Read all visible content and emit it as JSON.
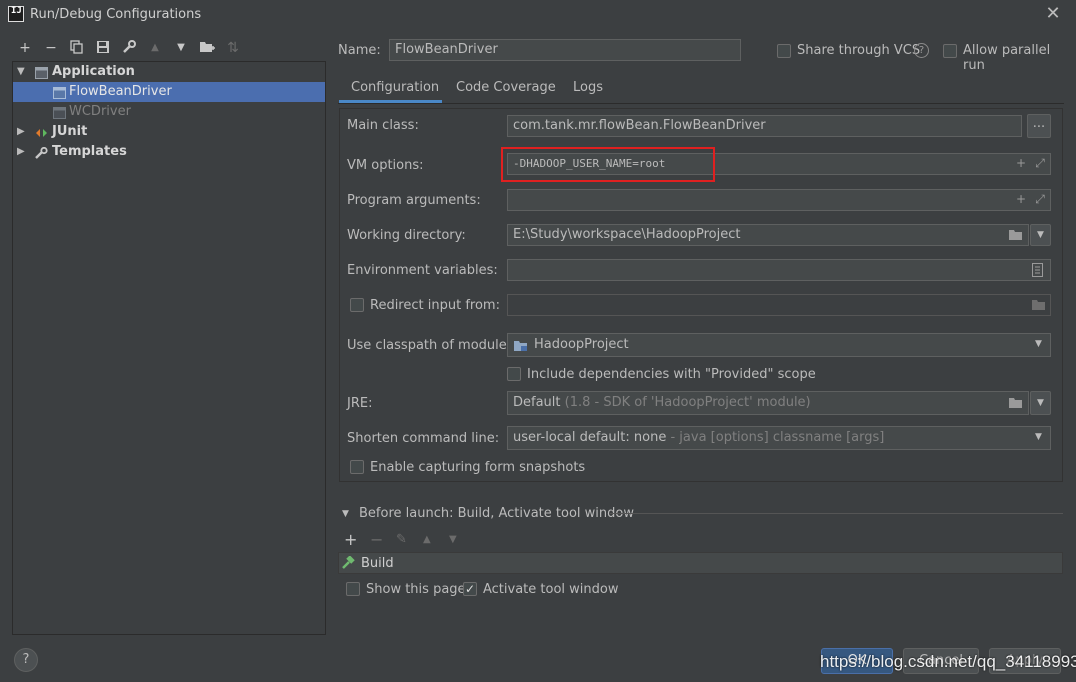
{
  "window": {
    "title": "Run/Debug Configurations",
    "app_icon": "intellij-icon",
    "app_icon_text": "IJ",
    "close_glyph": "✕"
  },
  "toolbar": {
    "icons": [
      "add-icon",
      "remove-icon",
      "copy-icon",
      "save-icon",
      "wrench-icon",
      "move-up-icon",
      "move-down-icon",
      "new-folder-icon",
      "sort-icon"
    ]
  },
  "tree": {
    "items": [
      {
        "label": "Application",
        "expanded": true,
        "icon": "application-icon"
      },
      {
        "label": "FlowBeanDriver",
        "selected": true,
        "icon": "config-icon"
      },
      {
        "label": "WCDriver",
        "selected": false,
        "icon": "config-icon"
      },
      {
        "label": "JUnit",
        "expanded": false,
        "icon": "junit-icon"
      },
      {
        "label": "Templates",
        "expanded": false,
        "icon": "wrench-icon"
      }
    ]
  },
  "header": {
    "name_label": "Name:",
    "name_value": "FlowBeanDriver",
    "share_label": "Share through VCS",
    "help_glyph": "?",
    "parallel_label": "Allow parallel run"
  },
  "tabs": [
    {
      "label": "Configuration",
      "active": true
    },
    {
      "label": "Code Coverage",
      "active": false
    },
    {
      "label": "Logs",
      "active": false
    }
  ],
  "form": {
    "main_class_label": "Main class:",
    "main_class_value": "com.tank.mr.flowBean.FlowBeanDriver",
    "browse_button": "...",
    "vm_options_label": "VM options:",
    "vm_options_value": "-DHADOOP_USER_NAME=root",
    "program_args_label": "Program arguments:",
    "program_args_value": "",
    "working_dir_label": "Working directory:",
    "working_dir_value": "E:\\Study\\workspace\\HadoopProject",
    "env_vars_label": "Environment variables:",
    "env_vars_value": "",
    "redirect_label": "Redirect input from:",
    "redirect_value": "",
    "classpath_label": "Use classpath of module:",
    "classpath_value": "HadoopProject",
    "include_deps_label": "Include dependencies with \"Provided\" scope",
    "jre_label": "JRE:",
    "jre_value": "Default",
    "jre_hint": "(1.8 - SDK of 'HadoopProject' module)",
    "shorten_label": "Shorten command line:",
    "shorten_value": "user-local default: none",
    "shorten_hint": "- java [options] classname [args]",
    "snapshots_label": "Enable capturing form snapshots"
  },
  "before_launch": {
    "title": "Before launch: Build, Activate tool window",
    "task": "Build",
    "show_page_label": "Show this page",
    "show_page_checked": false,
    "activate_label": "Activate tool window",
    "activate_checked": true
  },
  "footer": {
    "help_glyph": "?",
    "ok_label": "OK",
    "cancel_label": "Cancel",
    "apply_label": "Apply"
  },
  "watermark": "https://blog.csdn.net/qq_34118993",
  "colors": {
    "background": "#3c3f41",
    "selection": "#4b6eaf",
    "highlight_box": "#e02020",
    "ok_button": "#365880"
  }
}
